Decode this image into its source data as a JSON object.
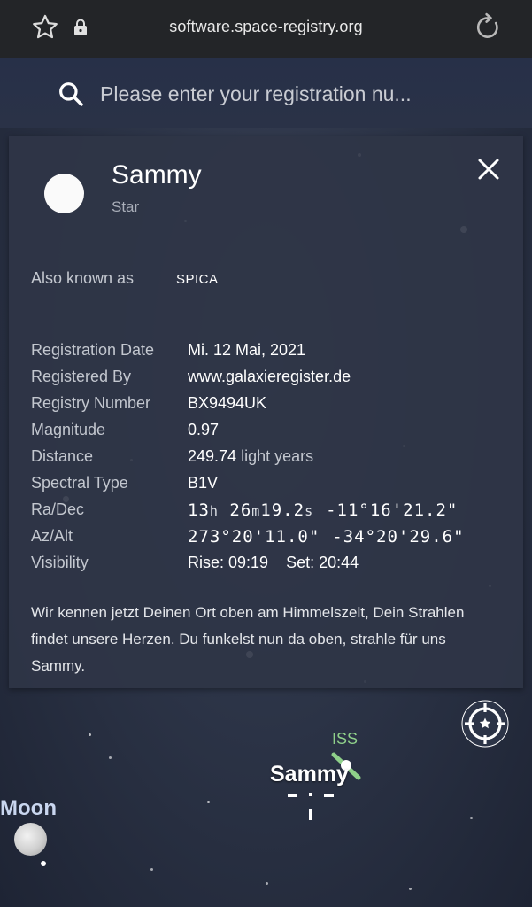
{
  "browser": {
    "url": "software.space-registry.org",
    "icons": [
      "star-icon",
      "lock-icon",
      "reload-icon"
    ]
  },
  "search": {
    "placeholder": "Please enter your registration nu..."
  },
  "object": {
    "name": "Sammy",
    "type": "Star",
    "also_known_as_label": "Also known as",
    "also_known_as_value": "SPICA",
    "details": {
      "registration_date": {
        "label": "Registration Date",
        "value": "Mi. 12 Mai, 2021"
      },
      "registered_by": {
        "label": "Registered By",
        "value": "www.galaxieregister.de"
      },
      "registry_number": {
        "label": "Registry Number",
        "value": "BX9494UK"
      },
      "magnitude": {
        "label": "Magnitude",
        "value": "0.97"
      },
      "distance": {
        "label": "Distance",
        "value": "249.74",
        "unit": "light years"
      },
      "spectral_type": {
        "label": "Spectral Type",
        "value": "B1V"
      },
      "ra_dec": {
        "label": "Ra/Dec",
        "ra_h": "13",
        "ra_h_unit": "h",
        "ra_m": "26",
        "ra_m_unit": "m",
        "ra_s": "19.2",
        "ra_s_unit": "s",
        "dec": "-11°16'21.2\""
      },
      "az_alt": {
        "label": "Az/Alt",
        "az": "273°20'11.0\"",
        "alt": "-34°20'29.6\""
      },
      "visibility": {
        "label": "Visibility",
        "rise": "Rise: 09:19",
        "set": "Set: 20:44"
      }
    },
    "description": "Wir kennen jetzt Deinen Ort oben am Himmelszelt, Dein Strahlen findet unsere Herzen. Du funkelst nun da oben, strahle für uns Sammy."
  },
  "sky": {
    "iss_label": "ISS",
    "target_label": "Sammy",
    "moon_label": "Moon",
    "colors": {
      "iss": "#8fd08a",
      "moon_label": "#c9d6ef"
    }
  },
  "colors": {
    "topbar": "#232528",
    "card": "#2f3546",
    "label": "#c3c7cf"
  }
}
